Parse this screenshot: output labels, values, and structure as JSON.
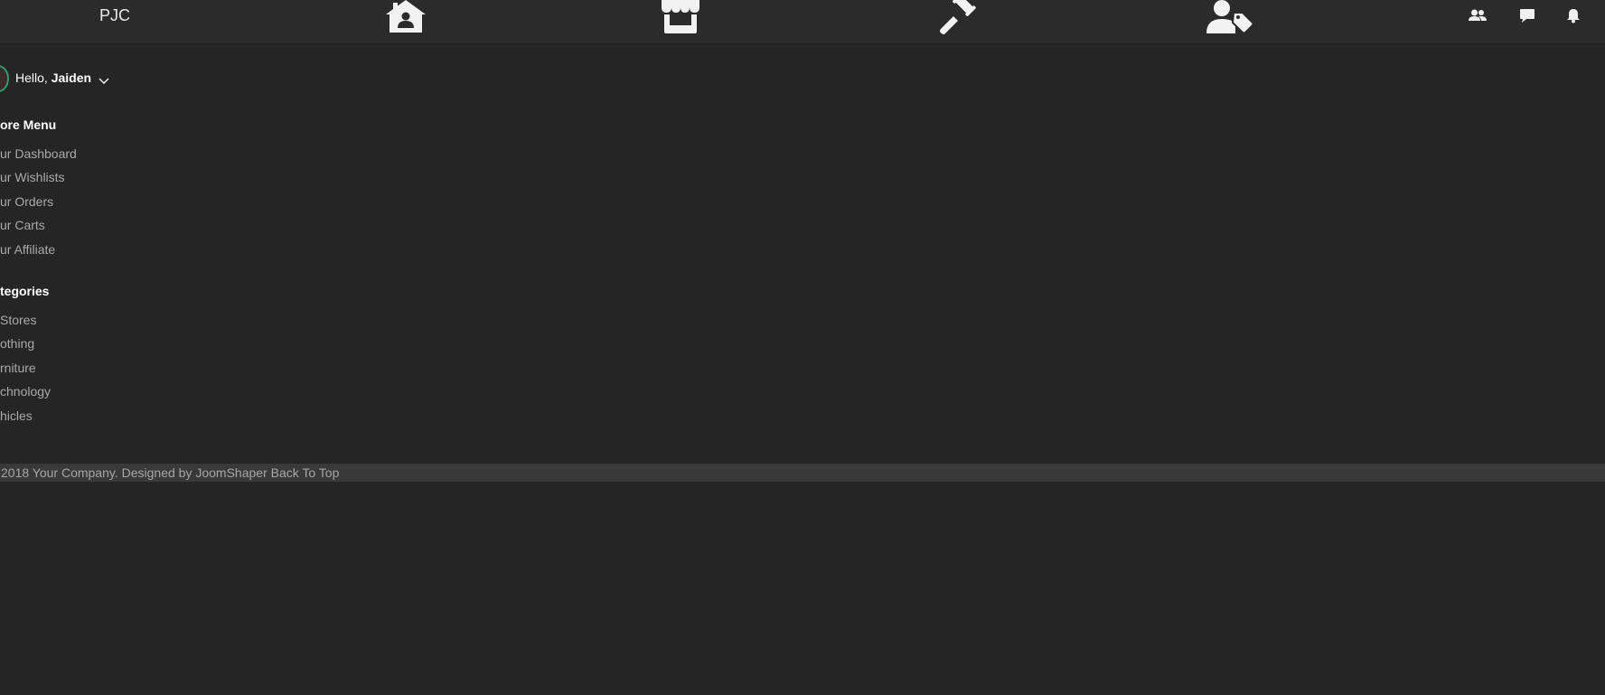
{
  "brand": "PJC",
  "nav": {
    "icons": [
      "home-user-icon",
      "storefront-icon",
      "gavel-icon",
      "user-tag-icon"
    ],
    "utility_icons": [
      "users-icon",
      "chat-icon",
      "bell-icon"
    ]
  },
  "sidebar": {
    "greeting_prefix": "Hello, ",
    "user_name": "Jaiden",
    "store_menu_title": "ore Menu",
    "store_menu": [
      "ur Dashboard",
      "ur Wishlists",
      "ur Orders",
      "ur Carts",
      "ur Affiliate"
    ],
    "categories_title": "tegories",
    "categories": [
      "Stores",
      "othing",
      "rniture",
      "chnology",
      "hicles"
    ]
  },
  "footer": {
    "copyright": "2018 Your Company. Designed by ",
    "designer": "JoomShaper",
    "back_to_top": "Back To Top"
  },
  "colors": {
    "background": "#252525",
    "topbar": "#2b2b2b",
    "footer": "#393939",
    "menu_text": "#a9a9a9",
    "avatar_ring": "#2e9a72"
  }
}
